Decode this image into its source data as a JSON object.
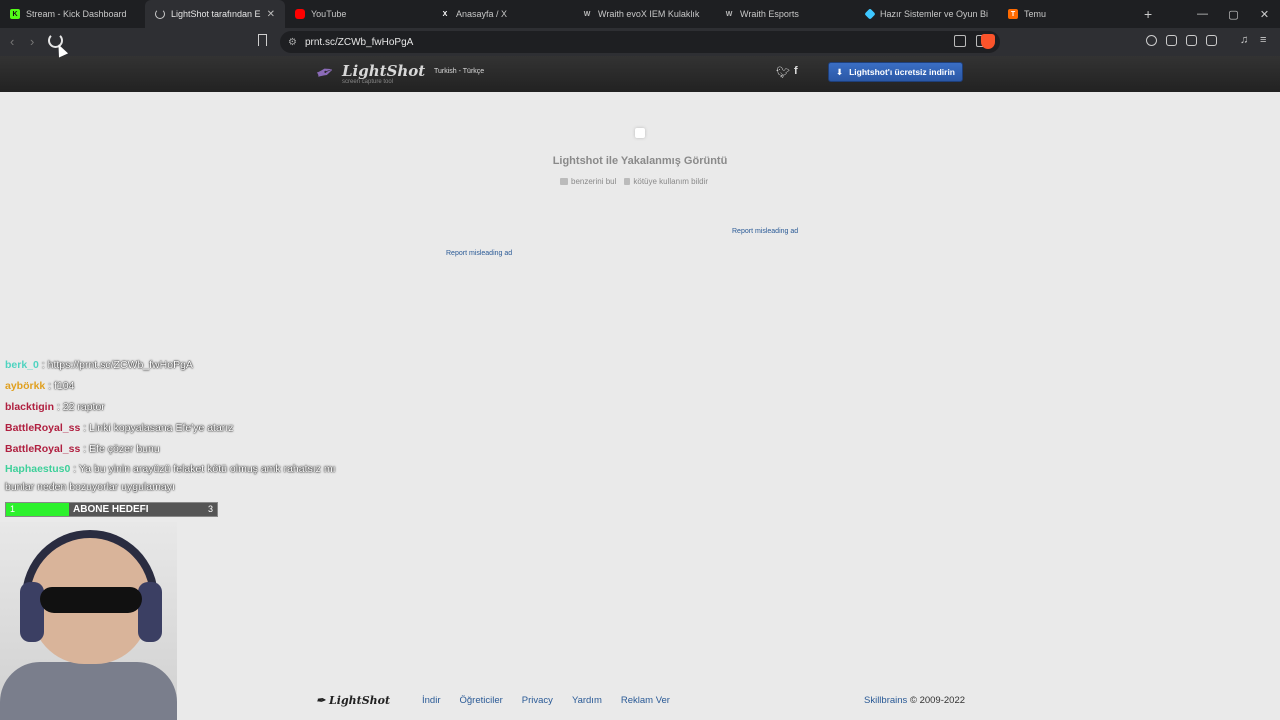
{
  "tabs": [
    {
      "label": "Stream - Kick Dashboard",
      "favicon_color": "#53fc18",
      "favicon_glyph": "K"
    },
    {
      "label": "LightShot tarafından Ekran",
      "favicon_color": "#cccccc",
      "favicon_glyph": "",
      "active": true
    },
    {
      "label": "YouTube",
      "favicon_color": "#ff0000",
      "favicon_glyph": ""
    },
    {
      "label": "Anasayfa / X",
      "favicon_color": "#ffffff",
      "favicon_glyph": "X"
    },
    {
      "label": "Wraith evoX IEM Kulaklık",
      "favicon_color": "#b0b0b0",
      "favicon_glyph": "W"
    },
    {
      "label": "Wraith Esports",
      "favicon_color": "#b0b0b0",
      "favicon_glyph": "W"
    },
    {
      "label": "Hazır Sistemler ve Oyun Bilgisa",
      "favicon_color": "#3ec7ff",
      "favicon_glyph": ""
    },
    {
      "label": "Temu",
      "favicon_color": "#ff6a00",
      "favicon_glyph": "T"
    }
  ],
  "browser": {
    "url": "prnt.sc/ZCWb_fwHoPgA",
    "new_tab": "+",
    "win_min": "—",
    "win_restore": "▢",
    "win_close": "✕"
  },
  "header": {
    "logo": "LightShot",
    "logo_sub": "screen capture tool",
    "language": "Turkish - Türkçe",
    "download_button": "Lightshot'ı ücretsiz indirin"
  },
  "main": {
    "title": "Lightshot ile Yakalanmış Görüntü",
    "action_similar": "benzerini bul",
    "action_report": "kötüye kullanım bildir",
    "ad_link_1": "Report misleading ad",
    "ad_link_2": "Report misleading ad"
  },
  "chat": [
    {
      "user": "berk_0",
      "color": "#4fd3c0",
      "msg": ": https://prnt.sc/ZCWb_fwHoPgA"
    },
    {
      "user": "aybörkk",
      "color": "#e0a020",
      "msg": ": f104"
    },
    {
      "user": "blacktigin",
      "color": "#b02040",
      "msg": ": 22 raptor"
    },
    {
      "user": "BattleRoyal_ss",
      "color": "#b02040",
      "msg": ": Linki kopyalasana Efe'ye atarız"
    },
    {
      "user": "BattleRoyal_ss",
      "color": "#b02040",
      "msg": ": Efe çözer bunu"
    },
    {
      "user": "Haphaestus0",
      "color": "#3ed09a",
      "msg": ": Ya bu yinin arayüzü felaket kötü olmuş amk rahatsız mı bunlar neden bozuyorlar uygulamayı"
    }
  ],
  "sub_goal": {
    "label": "ABONE HEDEFI",
    "current": "1",
    "target": "3",
    "progress": 0.3
  },
  "footer": {
    "logo": "LightShot",
    "links": [
      "İndir",
      "Öğreticiler",
      "Privacy",
      "Yardım",
      "Reklam Ver"
    ],
    "brand": "Skillbrains",
    "copyright": "© 2009-2022"
  }
}
